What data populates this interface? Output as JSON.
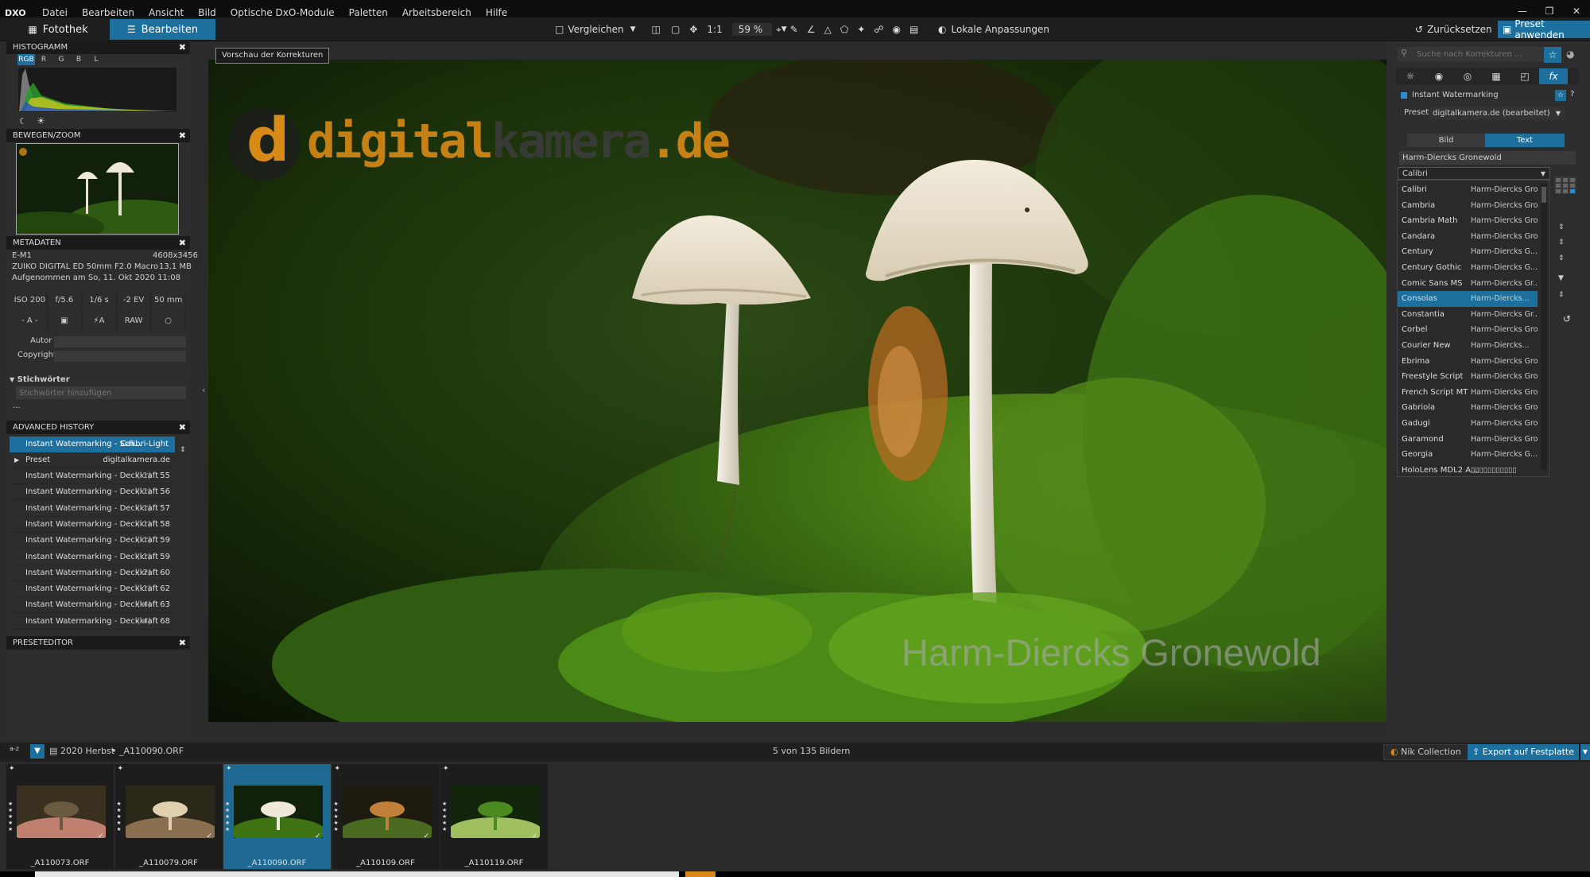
{
  "menubar": {
    "logo": "DXO",
    "items": [
      "Datei",
      "Bearbeiten",
      "Ansicht",
      "Bild",
      "Optische DxO-Module",
      "Paletten",
      "Arbeitsbereich",
      "Hilfe"
    ],
    "window_controls": [
      "—",
      "❐",
      "✕"
    ]
  },
  "toolbar": {
    "tab_fotothek": "Fotothek",
    "tab_bearbeiten": "Bearbeiten",
    "compare": "Vergleichen",
    "ratio": "1:1",
    "zoom": "59 %",
    "local": "Lokale Anpassungen",
    "reset": "Zurücksetzen",
    "apply_preset": "Preset anwenden"
  },
  "tooltip": "Vorschau der Korrekturen",
  "histogram": {
    "title": "HISTOGRAMM",
    "channels": [
      "RGB",
      "R",
      "G",
      "B",
      "L"
    ],
    "active": "RGB"
  },
  "zoom_panel": {
    "title": "BEWEGEN/ZOOM"
  },
  "metadata": {
    "title": "METADATEN",
    "camera": "E-M1",
    "resolution": "4608x3456",
    "lens": "ZUIKO DIGITAL ED 50mm F2.0 Macro",
    "size": "13,1 MB",
    "date": "Aufgenommen am So, 11. Okt 2020 11:08",
    "exif": [
      "ISO 200",
      "f/5.6",
      "1/6 s",
      "-2 EV",
      "50 mm"
    ],
    "modes": [
      "- A -",
      "▣",
      "⚡A",
      "RAW",
      "○"
    ],
    "autor_label": "Autor",
    "copyright_label": "Copyright"
  },
  "keywords": {
    "title": "Stichwörter",
    "placeholder": "Stichwörter hinzufügen",
    "more": "..."
  },
  "history": {
    "title": "ADVANCED HISTORY",
    "top": {
      "label": "Instant Watermarking - Sch...",
      "value": "Calibri-Light"
    },
    "preset": {
      "label": "Preset",
      "value": "digitalkamera.de"
    },
    "rows": [
      {
        "label": "Instant Watermarking - Deckkraft",
        "delta": "(-1)",
        "value": "55"
      },
      {
        "label": "Instant Watermarking - Deckkraft",
        "delta": "(-1)",
        "value": "56"
      },
      {
        "label": "Instant Watermarking - Deckkraft",
        "delta": "(-1)",
        "value": "57"
      },
      {
        "label": "Instant Watermarking - Deckkraft",
        "delta": "(-1)",
        "value": "58"
      },
      {
        "label": "Instant Watermarking - Deckkraft",
        "delta": "(-1)",
        "value": "59"
      },
      {
        "label": "Instant Watermarking - Deckkraft",
        "delta": "(-1)",
        "value": "59"
      },
      {
        "label": "Instant Watermarking - Deckkraft",
        "delta": "(-2)",
        "value": "60"
      },
      {
        "label": "Instant Watermarking - Deckkraft",
        "delta": "(-1)",
        "value": "62"
      },
      {
        "label": "Instant Watermarking - Deckkraft",
        "delta": "(-4)",
        "value": "63"
      },
      {
        "label": "Instant Watermarking - Deckkraft",
        "delta": "(-4)",
        "value": "68"
      }
    ]
  },
  "preset_editor": {
    "title": "PRESETEDITOR"
  },
  "image": {
    "logo_d": "d",
    "logo_text1": "digital",
    "logo_text2": "kamera",
    "logo_text3": ".de",
    "watermark": "Harm-Diercks Gronewold"
  },
  "right": {
    "search_placeholder": "Suche nach Korrekturen ...",
    "fx": "fx",
    "module": "Instant Watermarking",
    "preset_label": "Preset",
    "preset_value": "digitalkamera.de (bearbeitet)",
    "tab_bild": "Bild",
    "tab_text": "Text",
    "text_value": "Harm-Diercks Gronewold",
    "font_selected": "Calibri",
    "fonts": [
      {
        "name": "Calibri",
        "preview": "Harm-Diercks Gro..."
      },
      {
        "name": "Cambria",
        "preview": "Harm-Diercks Gro..."
      },
      {
        "name": "Cambria Math",
        "preview": "Harm-Diercks Gro..."
      },
      {
        "name": "Candara",
        "preview": "Harm-Diercks Gro..."
      },
      {
        "name": "Century",
        "preview": "Harm-Diercks G..."
      },
      {
        "name": "Century Gothic",
        "preview": "Harm-Diercks G..."
      },
      {
        "name": "Comic Sans MS",
        "preview": "Harm-Diercks Gr..."
      },
      {
        "name": "Consolas",
        "preview": "Harm-Diercks..."
      },
      {
        "name": "Constantia",
        "preview": "Harm-Diercks Gr..."
      },
      {
        "name": "Corbel",
        "preview": "Harm-Diercks Gro..."
      },
      {
        "name": "Courier New",
        "preview": "Harm-Diercks..."
      },
      {
        "name": "Ebrima",
        "preview": "Harm-Diercks Gro..."
      },
      {
        "name": "Freestyle Script",
        "preview": "Harm-Diercks Gronewold"
      },
      {
        "name": "French Script MT",
        "preview": "Harm-Diercks Gronewold"
      },
      {
        "name": "Gabriola",
        "preview": "Harm-Diercks Gronewold"
      },
      {
        "name": "Gadugi",
        "preview": "Harm-Diercks Gro..."
      },
      {
        "name": "Garamond",
        "preview": "Harm-Diercks Gro..."
      },
      {
        "name": "Georgia",
        "preview": "Harm-Diercks G..."
      },
      {
        "name": "HoloLens MDL2 A...",
        "preview": "▯▯▯▯▯▯▯▯▯▯▯"
      }
    ],
    "selected_index": 7
  },
  "status": {
    "sort": "a-z",
    "folder": "2020 Herbst",
    "file": "_A110090.ORF",
    "count": "5 von 135 Bildern",
    "nik": "Nik Collection",
    "export": "Export auf Festplatte"
  },
  "filmstrip": [
    {
      "name": "_A110073.ORF",
      "selected": false
    },
    {
      "name": "_A110079.ORF",
      "selected": false
    },
    {
      "name": "_A110090.ORF",
      "selected": true
    },
    {
      "name": "_A110109.ORF",
      "selected": false
    },
    {
      "name": "_A110119.ORF",
      "selected": false
    }
  ],
  "colors": {
    "accent": "#1d6f9e",
    "logo_orange": "#d88a17"
  }
}
